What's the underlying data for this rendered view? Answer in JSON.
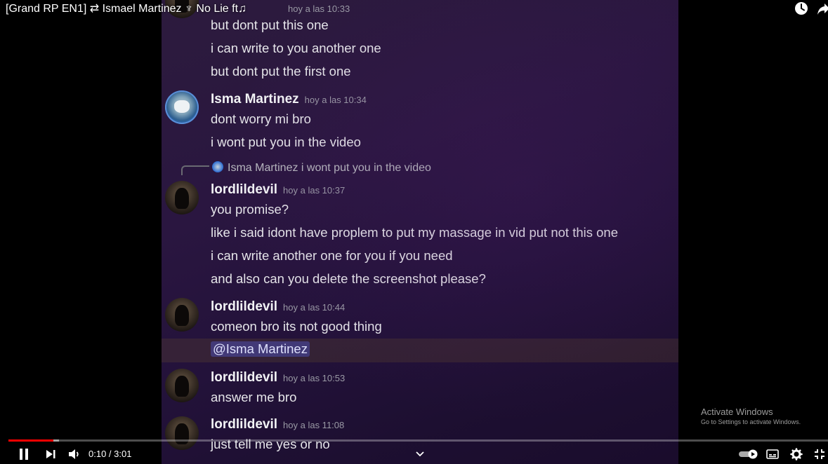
{
  "video_title": "[Grand RP EN1] ⇄ Ismael Martinez ♆ No Lie ft♫",
  "chat": {
    "first_group": {
      "author_hidden": "",
      "time": "hoy a las 10:33",
      "lines": [
        "but dont put this one",
        "i can write to you another one",
        "but dont put the first one"
      ]
    },
    "isma_group": {
      "author": "Isma Martinez",
      "time": "hoy a las 10:34",
      "lines": [
        "dont worry mi bro",
        "i wont put you in the video"
      ]
    },
    "reply": {
      "author": "Isma Martinez",
      "text": "i wont put you in the video"
    },
    "devil_group_1": {
      "author": "lordlildevil",
      "time": "hoy a las 10:37",
      "lines": [
        "you promise?",
        "like i said idont have proplem to put my massage in vid put not this one",
        "i can write another one for you if you need",
        "and also can you delete the screenshot please?"
      ]
    },
    "devil_group_2": {
      "author": "lordlildevil",
      "time": "hoy a las 10:44",
      "lines": [
        "comeon bro its not good thing"
      ],
      "mention": "@Isma Martinez"
    },
    "devil_group_3": {
      "author": "lordlildevil",
      "time": "hoy a las 10:53",
      "lines": [
        "answer me bro"
      ]
    },
    "devil_group_4": {
      "author": "lordlildevil",
      "time": "hoy a las 11:08",
      "lines": [
        "just tell me yes or no"
      ]
    }
  },
  "watermark": {
    "line1": "Activate Windows",
    "line2": "Go to Settings to activate Windows."
  },
  "player": {
    "current_time": "0:10",
    "separator": " / ",
    "duration": "3:01",
    "progress_fraction": 0.055,
    "buffered_fraction": 0.062,
    "colors": {
      "played": "#ff0000",
      "accent": "#ffffff"
    },
    "icons": [
      "pause-icon",
      "next-icon",
      "volume-icon",
      "chevron-down-icon",
      "autoplay-toggle-icon",
      "subtitles-icon",
      "settings-gear-icon",
      "exit-fullscreen-icon",
      "watch-later-clock-icon",
      "share-arrow-icon"
    ]
  }
}
